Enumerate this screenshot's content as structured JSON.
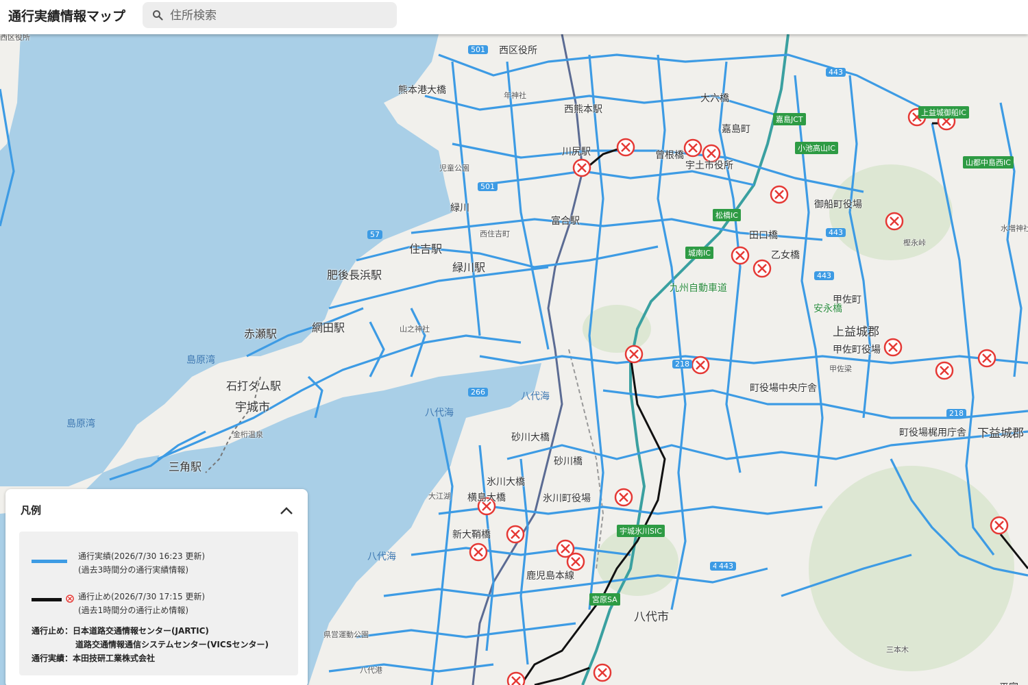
{
  "header": {
    "title": "通行実績情報マップ"
  },
  "search": {
    "placeholder": "住所検索",
    "value": ""
  },
  "colors": {
    "road_traffic": "#3d9be4",
    "road_closed": "#111111",
    "sea": "#a9cfe7",
    "land": "#f1f0ec",
    "closure_marker": "#e53935",
    "expressway_sign": "#2e9b44"
  },
  "map_labels": {
    "places": [
      "西区役所",
      "熊本港大橋",
      "年神社",
      "西熊本駅",
      "川尻駅",
      "緑川",
      "宇土市役所",
      "富合駅",
      "住吉駅",
      "緑川駅",
      "網田駅",
      "肥後長浜駅",
      "赤瀬駅",
      "石打ダム駅",
      "宇城市",
      "島原湾",
      "三角駅",
      "島原湾",
      "八代海",
      "八代海",
      "八代海",
      "砂川大橋",
      "砂川橋",
      "氷川大橋",
      "氷川町役場",
      "横島大橋",
      "新大鞘橋",
      "鹿児島本線",
      "八代市",
      "田口橋",
      "乙女橋",
      "上益城郡",
      "甲佐町",
      "甲佐町役場",
      "御船町役場",
      "町役場中央庁舎",
      "町役場梶用庁舎",
      "下益城郡",
      "大六橋",
      "嘉島町",
      "曾根橋",
      "九州自動車道",
      "安永橋",
      "平家",
      "三本木",
      "甲佐町役場"
    ],
    "small_places": [
      "西区役所",
      "西住吉町",
      "児童公園",
      "山之神社",
      "金桁温泉",
      "大江湖",
      "県営運動公園",
      "八代港",
      "樫永峠",
      "水増神社",
      "甲佐梁"
    ],
    "expressway": [
      "上益城御船IC",
      "小池高山IC",
      "山都中島西IC",
      "城南IC",
      "嘉島JCT",
      "松橋IC",
      "宇城氷川SIC",
      "宮原SA"
    ],
    "route_numbers": [
      "501",
      "501",
      "57",
      "266",
      "218",
      "218",
      "443",
      "443",
      "443",
      "445",
      "443"
    ]
  },
  "legend": {
    "title": "凡例",
    "traffic_label": "通行実績(2026/7/30 16:23 更新)",
    "traffic_sub": "(過去3時間分の通行実績情報)",
    "closure_label": "通行止め(2026/7/30 17:15 更新)",
    "closure_sub": "(過去1時間分の通行止め情報)",
    "source_closure": "通行止め：日本道路交通情報センター(JARTIC)",
    "source_closure2": "道路交通情報通信システムセンター(VICSセンター)",
    "source_traffic": "通行実績：本田技研工業株式会社"
  }
}
